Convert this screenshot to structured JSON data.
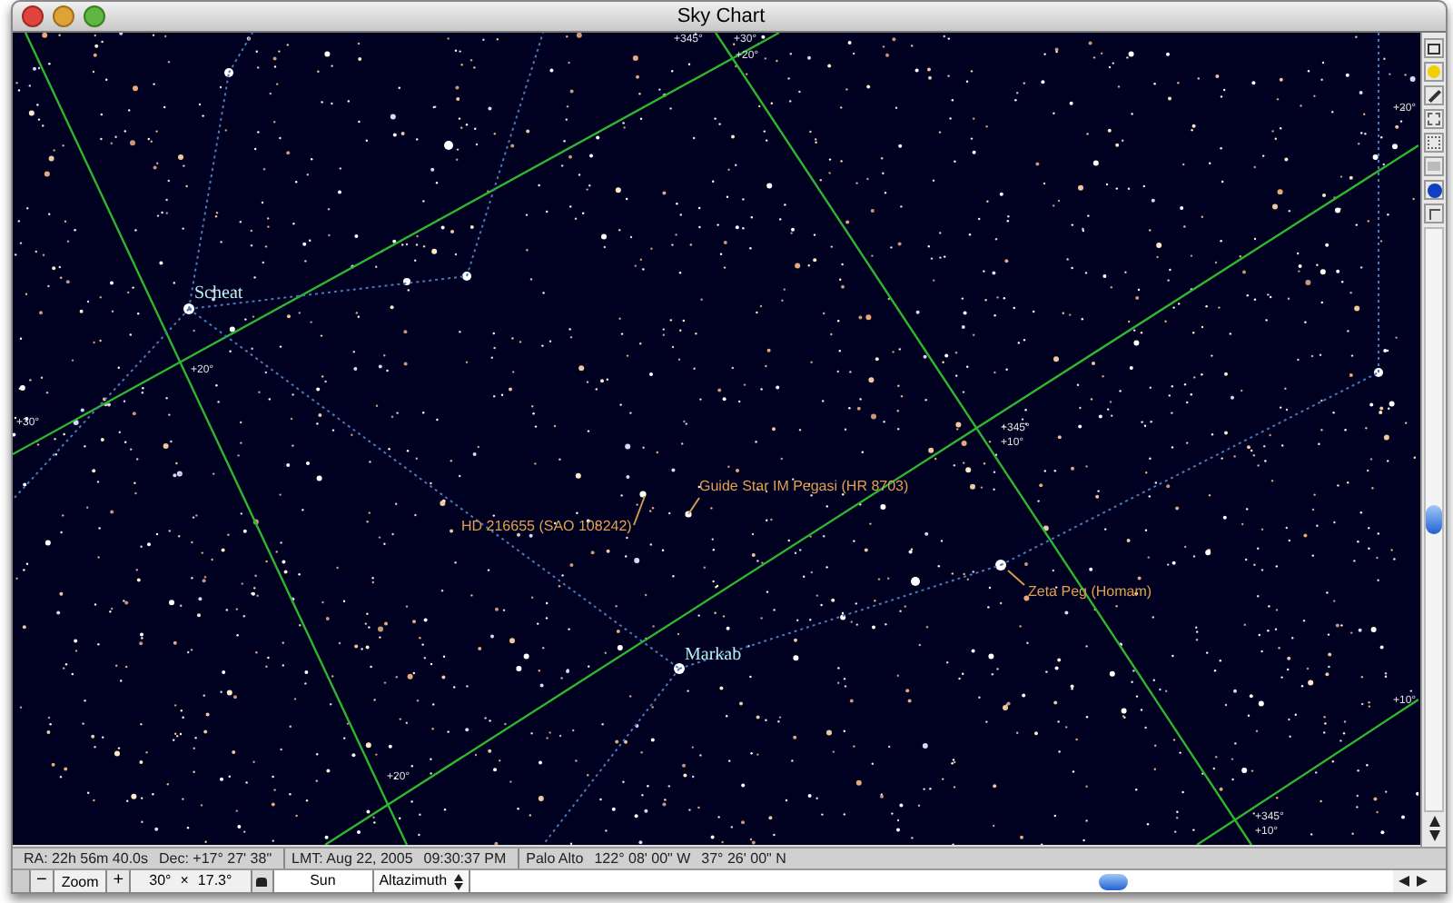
{
  "window": {
    "title": "Sky Chart"
  },
  "chart": {
    "star_labels": [
      {
        "kind": "name",
        "text": "Scheat"
      },
      {
        "kind": "name",
        "text": "Markab"
      },
      {
        "kind": "catalog",
        "text": "HD 216655 (SAO 108242)"
      },
      {
        "kind": "catalog",
        "text": "Guide Star IM Pegasi (HR 8703)"
      },
      {
        "kind": "catalog",
        "text": "Zeta Peg (Homam)"
      }
    ],
    "grid_labels": [
      "+345°",
      "+30°",
      "+20°",
      "+20°",
      "+30°",
      "+345°",
      "+10°",
      "+20°",
      "+20°",
      "+345°",
      "+10°",
      "+10°"
    ]
  },
  "status_bar": [
    "RA: 22h 56m 40.0s",
    "Dec: +17° 27' 38\"",
    "LMT: Aug 22, 2005",
    "09:30:37 PM",
    "Palo Alto",
    "122° 08' 00\" W",
    "37° 26' 00\" N"
  ],
  "controls": {
    "zoom_out": "−",
    "zoom_label": "Zoom",
    "zoom_in": "+",
    "fov_width": "30°",
    "times": "×",
    "fov_height": "17.3°",
    "object": "Sun",
    "projection": "Altazimuth"
  }
}
